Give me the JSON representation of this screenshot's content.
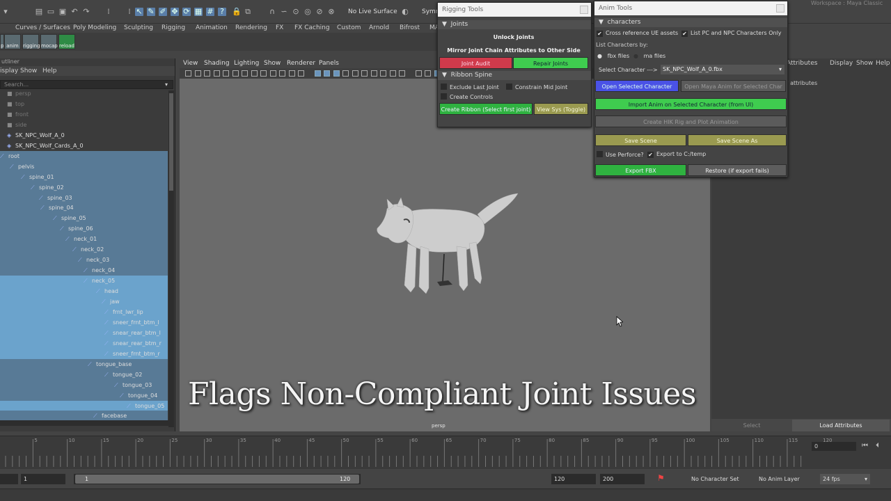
{
  "toolbar": {
    "live_surface": "No Live Surface",
    "symmetry": "Symm",
    "workspace": "Workspace : Maya Classic"
  },
  "shelf": {
    "tabs": [
      "Curves / Surfaces",
      "Poly Modeling",
      "Sculpting",
      "Rigging",
      "Animation",
      "Rendering",
      "FX",
      "FX Caching",
      "Custom",
      "Arnold",
      "Bifrost",
      "MA"
    ],
    "buttons": [
      "p",
      "anim",
      "rigging",
      "mocap",
      "reload"
    ]
  },
  "outliner": {
    "title": "utliner",
    "menu": [
      "isplay",
      "Show",
      "Help"
    ],
    "search_placeholder": "Search...",
    "items": [
      {
        "label": "persp",
        "type": "camera"
      },
      {
        "label": "top",
        "type": "camera"
      },
      {
        "label": "front",
        "type": "camera"
      },
      {
        "label": "side",
        "type": "camera"
      },
      {
        "label": "SK_NPC_Wolf_A_0",
        "type": "mesh"
      },
      {
        "label": "SK_NPC_Wolf_Cards_A_0",
        "type": "mesh"
      },
      {
        "label": "root",
        "type": "joint"
      },
      {
        "label": "pelvis",
        "type": "joint"
      },
      {
        "label": "spine_01",
        "type": "joint"
      },
      {
        "label": "spine_02",
        "type": "joint"
      },
      {
        "label": "spine_03",
        "type": "joint"
      },
      {
        "label": "spine_04",
        "type": "joint"
      },
      {
        "label": "spine_05",
        "type": "joint"
      },
      {
        "label": "spine_06",
        "type": "joint"
      },
      {
        "label": "neck_01",
        "type": "joint"
      },
      {
        "label": "neck_02",
        "type": "joint"
      },
      {
        "label": "neck_03",
        "type": "joint"
      },
      {
        "label": "neck_04",
        "type": "joint"
      },
      {
        "label": "neck_05",
        "type": "joint"
      },
      {
        "label": "head",
        "type": "joint"
      },
      {
        "label": "jaw",
        "type": "joint"
      },
      {
        "label": "frnt_lwr_lip",
        "type": "joint"
      },
      {
        "label": "sneer_frnt_btm_l",
        "type": "joint"
      },
      {
        "label": "snear_rear_btm_l",
        "type": "joint"
      },
      {
        "label": "snear_rear_btm_r",
        "type": "joint"
      },
      {
        "label": "sneer_frnt_btm_r",
        "type": "joint"
      },
      {
        "label": "tongue_base",
        "type": "joint"
      },
      {
        "label": "tongue_02",
        "type": "joint"
      },
      {
        "label": "tongue_03",
        "type": "joint"
      },
      {
        "label": "tongue_04",
        "type": "joint"
      },
      {
        "label": "tongue_05",
        "type": "joint"
      },
      {
        "label": "facebase",
        "type": "joint"
      }
    ]
  },
  "viewport": {
    "menu": [
      "View",
      "Shading",
      "Lighting",
      "Show",
      "Renderer",
      "Panels"
    ],
    "camera_label": "persp"
  },
  "caption": "Flags Non-Compliant Joint Issues",
  "rigging_tools": {
    "title": "Rigging Tools",
    "section_joints": "Joints",
    "unlock_joints": "Unlock Joints",
    "mirror_label": "Mirror Joint Chain Attributes to Other Side",
    "joint_audit": "Joint Audit",
    "repair_joints": "Repair Joints",
    "section_ribbon": "Ribbon Spine",
    "exclude_last": "Exclude Last Joint",
    "constrain_mid": "Constrain Mid Joint",
    "create_controls": "Create Controls",
    "create_ribbon": "Create Ribbon (Select first joint)",
    "view_sys": "View Sys (Toggle)"
  },
  "anim_tools": {
    "title": "Anim Tools",
    "section_characters": "characters",
    "cross_ref": "Cross reference UE assets",
    "list_pc_npc": "List PC and NPC Characters Only",
    "list_by": "List Characters by:",
    "fbx_files": "fbx files",
    "ma_files": "ma files",
    "select_character": "Select Character --->",
    "character_value": "SK_NPC_Wolf_A_0.fbx",
    "open_selected": "Open Selected Character",
    "open_maya_anim": "Open Maya Anim for Selected Char",
    "import_anim": "Import Anim on Selected Character (from UI)",
    "create_hik": "Create HIK Rig and Plot Animation",
    "save_scene": "Save Scene",
    "save_scene_as": "Save Scene As",
    "use_perforce": "Use Perforce?",
    "export_ctemp": "Export to C:/temp",
    "export_fbx": "Export FBX",
    "restore": "Restore (if export fails)"
  },
  "attribute_editor": {
    "menu": [
      "Attributes",
      "Display",
      "Show",
      "Help"
    ],
    "hint": "w attributes",
    "select": "Select",
    "load_attributes": "Load Attributes"
  },
  "timeline": {
    "ticks": [
      "5",
      "10",
      "15",
      "20",
      "25",
      "30",
      "35",
      "40",
      "45",
      "50",
      "55",
      "60",
      "65",
      "70",
      "75",
      "80",
      "85",
      "90",
      "95",
      "100",
      "105",
      "110",
      "115",
      "120"
    ],
    "current_frame": "0"
  },
  "range": {
    "start": "1",
    "slider_start": "1",
    "slider_end": "120",
    "end": "120",
    "anim_end": "200",
    "character_set": "No Character Set",
    "anim_layer": "No Anim Layer",
    "fps": "24 fps"
  }
}
